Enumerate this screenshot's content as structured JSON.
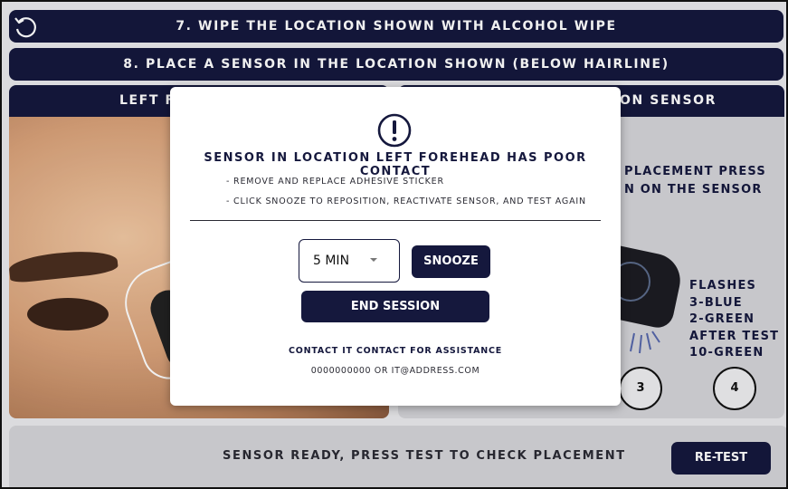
{
  "steps": {
    "step7": "7. WIPE THE LOCATION SHOWN WITH ALCOHOL WIPE",
    "step8": "8. PLACE A SENSOR IN THE LOCATION SHOWN (BELOW HAIRLINE)"
  },
  "left_panel": {
    "header": "LEFT F"
  },
  "right_panel": {
    "header": "ON SENSOR",
    "instruction": "PLACEMENT PRESS\nN ON THE SENSOR",
    "flashes": [
      "FLASHES",
      "3-BLUE",
      "2-GREEN",
      "AFTER TEST",
      "10-GREEN"
    ],
    "step_numbers": [
      "3",
      "4"
    ]
  },
  "modal": {
    "icon": "alert-circle-icon",
    "title": "SENSOR IN LOCATION LEFT FOREHEAD HAS POOR CONTACT",
    "bullets": [
      "- REMOVE AND REPLACE ADHESIVE STICKER",
      "- CLICK SNOOZE TO REPOSITION, REACTIVATE SENSOR, AND TEST AGAIN"
    ],
    "snooze_select": "5 MIN",
    "snooze_label": "SNOOZE",
    "end_session_label": "END SESSION",
    "contact_heading": "CONTACT IT CONTACT FOR ASSISTANCE",
    "contact_info": "0000000000 OR IT@ADDRESS.COM"
  },
  "footer": {
    "status": "SENSOR READY, PRESS TEST TO CHECK PLACEMENT",
    "retest_label": "RE-TEST"
  },
  "colors": {
    "primary": "#15183d",
    "accent_green": "#2f9a4a"
  }
}
